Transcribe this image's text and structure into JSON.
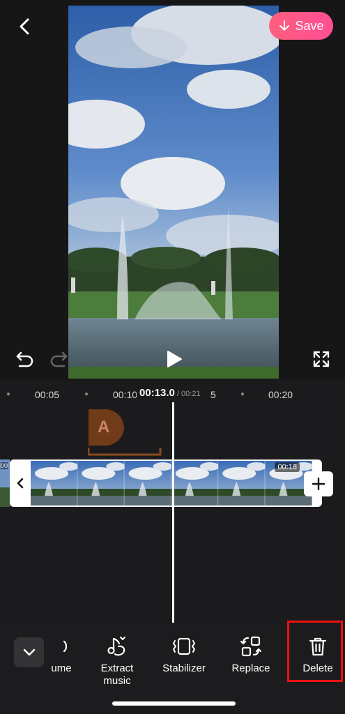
{
  "header": {
    "save_label": "Save"
  },
  "icons": {
    "back": "chevron-left-icon",
    "save": "arrow-down-icon",
    "undo": "undo-icon",
    "redo": "redo-icon",
    "play": "play-icon",
    "fullscreen": "fullscreen-icon",
    "add_clip": "plus-icon",
    "collapse": "chevron-down-icon"
  },
  "timeline": {
    "ruler": [
      "00:05",
      "00:10",
      "5",
      "00:20"
    ],
    "current_time": "00:13.0",
    "separator_total": " / 00:21",
    "text_track_letter": "A",
    "clip_duration": "00:18",
    "prev_clip_label": "00"
  },
  "toolbar": {
    "items": [
      {
        "label": "ume",
        "icon": "volume-icon"
      },
      {
        "label": "Extract\nmusic",
        "icon": "extract-music-icon"
      },
      {
        "label": "Stabilizer",
        "icon": "stabilizer-icon"
      },
      {
        "label": "Replace",
        "icon": "replace-icon"
      },
      {
        "label": "Delete",
        "icon": "trash-icon"
      }
    ]
  },
  "colors": {
    "accent": "#ff4e93",
    "background": "#1b1b1d",
    "highlight": "#e11111",
    "text_track": "#b35a22"
  }
}
